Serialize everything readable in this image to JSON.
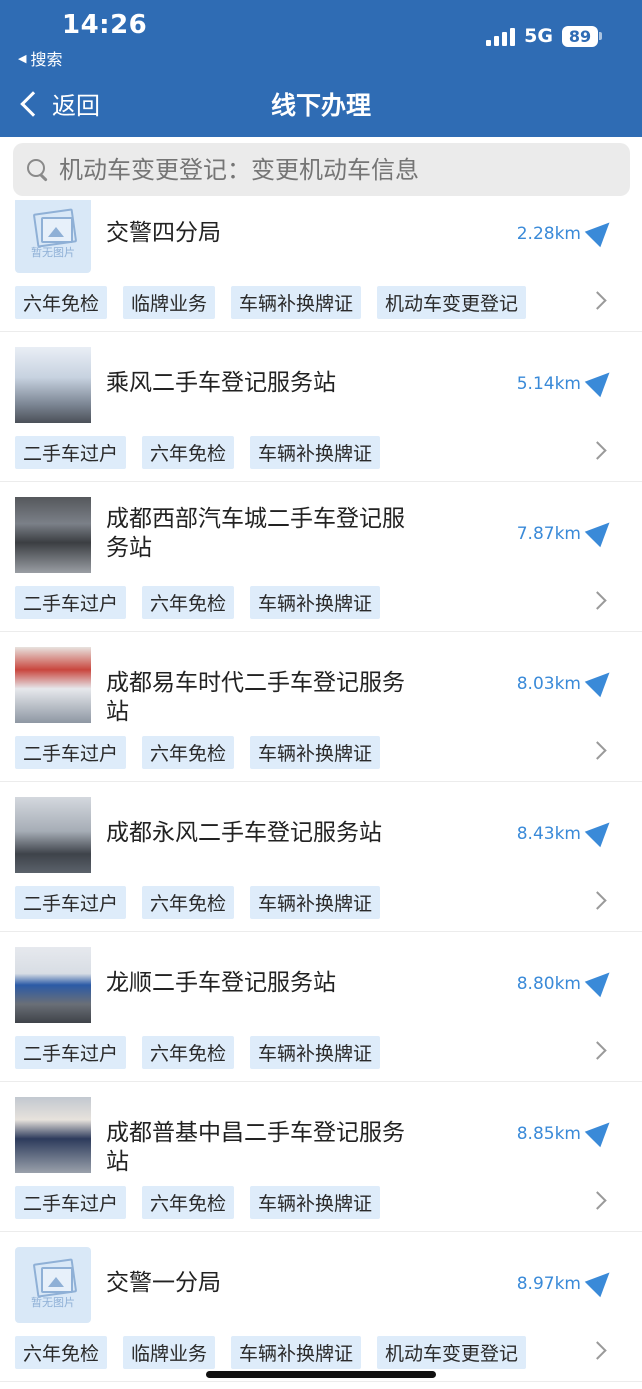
{
  "status_bar": {
    "time": "14:26",
    "back_app": "搜索",
    "network": "5G",
    "battery": "89"
  },
  "navbar": {
    "back_label": "返回",
    "title": "线下办理"
  },
  "search": {
    "placeholder": "机动车变更登记：变更机动车信息"
  },
  "placeholder_image_text": "暂无图片",
  "stations": [
    {
      "name": "交警四分局",
      "distance": "2.28km",
      "tags": [
        "六年免检",
        "临牌业务",
        "车辆补换牌证",
        "机动车变更登记"
      ]
    },
    {
      "name": "乘风二手车登记服务站",
      "distance": "5.14km",
      "tags": [
        "二手车过户",
        "六年免检",
        "车辆补换牌证"
      ]
    },
    {
      "name": "成都西部汽车城二手车登记服务站",
      "distance": "7.87km",
      "tags": [
        "二手车过户",
        "六年免检",
        "车辆补换牌证"
      ]
    },
    {
      "name": "成都易车时代二手车登记服务站",
      "distance": "8.03km",
      "tags": [
        "二手车过户",
        "六年免检",
        "车辆补换牌证"
      ]
    },
    {
      "name": "成都永风二手车登记服务站",
      "distance": "8.43km",
      "tags": [
        "二手车过户",
        "六年免检",
        "车辆补换牌证"
      ]
    },
    {
      "name": "龙顺二手车登记服务站",
      "distance": "8.80km",
      "tags": [
        "二手车过户",
        "六年免检",
        "车辆补换牌证"
      ]
    },
    {
      "name": "成都普基中昌二手车登记服务站",
      "distance": "8.85km",
      "tags": [
        "二手车过户",
        "六年免检",
        "车辆补换牌证"
      ]
    },
    {
      "name": "交警一分局",
      "distance": "8.97km",
      "tags": [
        "六年免检",
        "临牌业务",
        "车辆补换牌证",
        "机动车变更登记"
      ]
    }
  ]
}
